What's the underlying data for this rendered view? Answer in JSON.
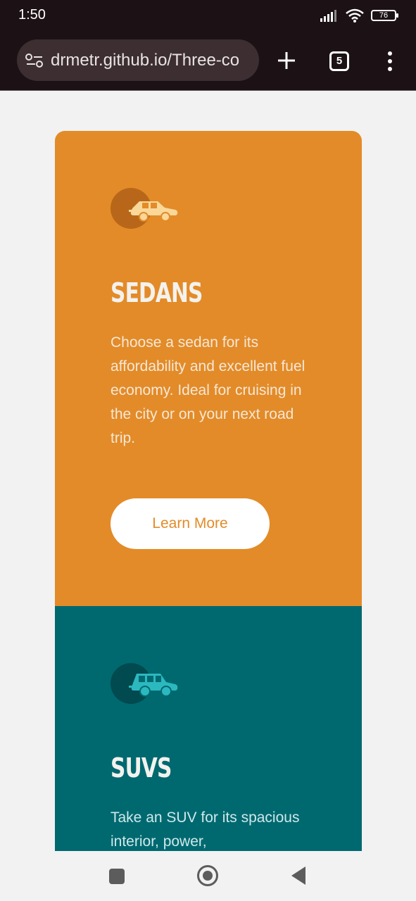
{
  "status": {
    "time": "1:50",
    "battery": "76",
    "icons": [
      "signal-icon",
      "wifi-icon",
      "battery-icon"
    ]
  },
  "browser": {
    "url": "drmetr.github.io/Three-co",
    "tab_count": "5",
    "icons": [
      "site-settings-icon",
      "new-tab-icon",
      "tabs-icon",
      "menu-icon"
    ]
  },
  "cards": [
    {
      "title": "SEDANS",
      "text": "Choose a sedan for its affordability and excellent fuel economy. Ideal for cruising in the city or on your next road trip.",
      "button": "Learn More",
      "icon": "sedan-icon",
      "color": "#e38b28"
    },
    {
      "title": "SUVS",
      "text": "Take an SUV for its spacious interior, power,",
      "icon": "suv-icon",
      "color": "#006970"
    }
  ],
  "colors": {
    "sedan_bg": "#e38b28",
    "suv_bg": "#006970",
    "page_bg": "#f2f2f2",
    "browser_bg": "#1c1216"
  },
  "nav": {
    "icons": [
      "recent-apps-icon",
      "home-icon",
      "back-icon"
    ]
  }
}
